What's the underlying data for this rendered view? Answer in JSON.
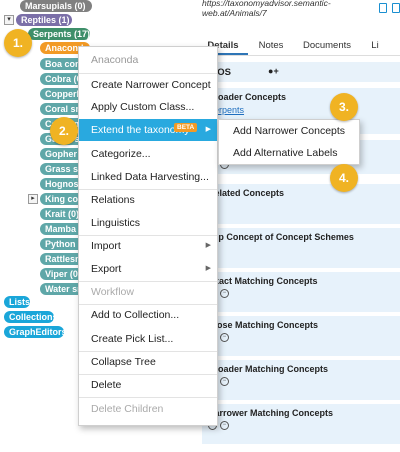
{
  "tree": {
    "nodes": [
      {
        "label": "Marsupials (0)"
      },
      {
        "label": "Reptiles (1)"
      },
      {
        "label": "Serpents (17)"
      },
      {
        "label": "Anaconda (0)"
      },
      {
        "label": "Boa constrictor (0)"
      },
      {
        "label": "Cobra (0)"
      },
      {
        "label": "Copperhead (0)"
      },
      {
        "label": "Coral snake (0)"
      },
      {
        "label": "Cottonmouth (0)"
      },
      {
        "label": "Garter snake (0)"
      },
      {
        "label": "Gopher snake (0)"
      },
      {
        "label": "Grass snake (0)"
      },
      {
        "label": "Hognose snake (0)"
      },
      {
        "label": "King cobra (0)"
      },
      {
        "label": "Krait (0)"
      },
      {
        "label": "Mamba (0)"
      },
      {
        "label": "Python (0)"
      },
      {
        "label": "Rattlesnake (0)"
      },
      {
        "label": "Viper (0)"
      },
      {
        "label": "Water snake (0)"
      }
    ],
    "toggles": {
      "reptiles": "▾",
      "king_cobra": "▸"
    },
    "roots": [
      {
        "label": "Lists"
      },
      {
        "label": "Collections"
      },
      {
        "label": "GraphEditors"
      }
    ]
  },
  "header": {
    "url": "https://taxonomyadvisor.semantic-web.at/Animals/7"
  },
  "tabs": [
    "Details",
    "Notes",
    "Documents",
    "Li"
  ],
  "subtabs": {
    "skos": "SKOS",
    "user_icon": "user-add-icon",
    "plus": "+"
  },
  "sections": [
    {
      "title": "Broader Concepts",
      "link": "Serpents"
    },
    {
      "title": "Related Concepts"
    },
    {
      "title": "Top Concept of Concept Schemes"
    },
    {
      "title": "Exact Matching Concepts"
    },
    {
      "title": "Close Matching Concepts"
    },
    {
      "title": "Broader Matching Concepts"
    },
    {
      "title": "Narrower Matching Concepts"
    }
  ],
  "context_menu": {
    "title": "Anaconda",
    "items": [
      {
        "label": "Create Narrower Concept"
      },
      {
        "label": "Apply Custom Class..."
      },
      {
        "label": "Extend the taxonomy",
        "badge": "BETA"
      },
      {
        "label": "Categorize..."
      },
      {
        "label": "Linked Data Harvesting..."
      },
      {
        "label": "Relations"
      },
      {
        "label": "Linguistics"
      },
      {
        "label": "Import"
      },
      {
        "label": "Export"
      },
      {
        "label": "Workflow"
      },
      {
        "label": "Add to Collection..."
      },
      {
        "label": "Create Pick List..."
      },
      {
        "label": "Collapse Tree"
      },
      {
        "label": "Delete"
      },
      {
        "label": "Delete Children"
      }
    ]
  },
  "submenu": {
    "items": [
      {
        "label": "Add Narrower Concepts"
      },
      {
        "label": "Add Alternative Labels"
      }
    ]
  },
  "callouts": [
    "1.",
    "2.",
    "3.",
    "4."
  ],
  "colors": {
    "accent": "#29a9df",
    "callout": "#f0b323",
    "selected_node": "#f29a25"
  }
}
